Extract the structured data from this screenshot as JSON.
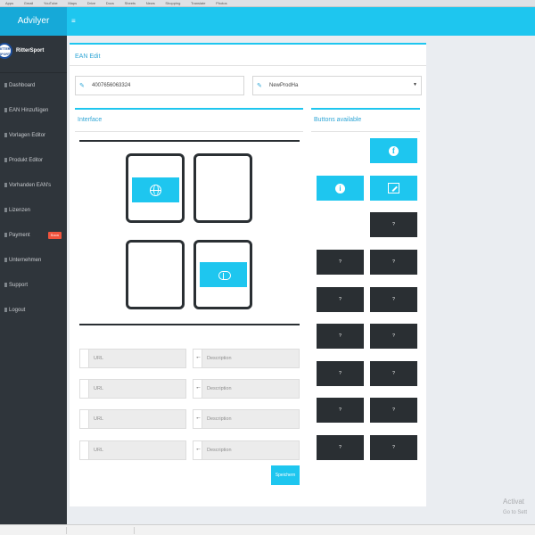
{
  "browser": {
    "bookmarks": [
      "Apps",
      "Gmail",
      "YouTube",
      "Maps",
      "Drive",
      "Docs",
      "Sheets",
      "News",
      "Shopping",
      "Translate",
      "Photos"
    ]
  },
  "app": {
    "brand": "Advilyer",
    "menu_toggle": "≡"
  },
  "profile": {
    "logo_text": "RITTER SPORT",
    "name": "RitterSport"
  },
  "nav": [
    {
      "label": "Dashboard",
      "icon": "dashboard-icon"
    },
    {
      "label": "EAN Hinzufügen",
      "icon": "add-icon"
    },
    {
      "label": "Vorlagen Editor",
      "icon": "template-icon"
    },
    {
      "label": "Produkt Editor",
      "icon": "edit-icon"
    },
    {
      "label": "Vorhanden EAN's",
      "icon": "list-icon"
    },
    {
      "label": "Lizenzen",
      "icon": "license-icon"
    },
    {
      "label": "Payment",
      "icon": "payment-icon",
      "badge": "Soon"
    },
    {
      "label": "Unternehmen",
      "icon": "company-icon"
    },
    {
      "label": "Support",
      "icon": "support-icon"
    },
    {
      "label": "Logout",
      "icon": "logout-icon"
    }
  ],
  "ean_edit": {
    "title": "EAN Edit",
    "ean_value": "4007656063324",
    "product_select": "NewProdHa"
  },
  "interface": {
    "title": "Interface",
    "slots": [
      {
        "content": "www-globe-icon"
      },
      {
        "content": ""
      },
      {
        "content": ""
      },
      {
        "content": "cloud-upload-icon"
      }
    ],
    "link_rows": [
      {
        "url_placeholder": "URL",
        "desc_placeholder": "Description"
      },
      {
        "url_placeholder": "URL",
        "desc_placeholder": "Description"
      },
      {
        "url_placeholder": "URL",
        "desc_placeholder": "Description"
      },
      {
        "url_placeholder": "URL",
        "desc_placeholder": "Description"
      }
    ],
    "save_label": "Speichern"
  },
  "buttons_available": {
    "title": "Buttons available",
    "facebook_icon": "f",
    "info_icon": "i",
    "unknown_label": "?"
  },
  "colors": {
    "accent": "#1ec6ef",
    "sidebar": "#2f353b",
    "dark_tile": "#2a2f33",
    "badge": "#f0533d"
  },
  "watermark": {
    "line1": "Activat",
    "line2": "Go to Sett"
  }
}
